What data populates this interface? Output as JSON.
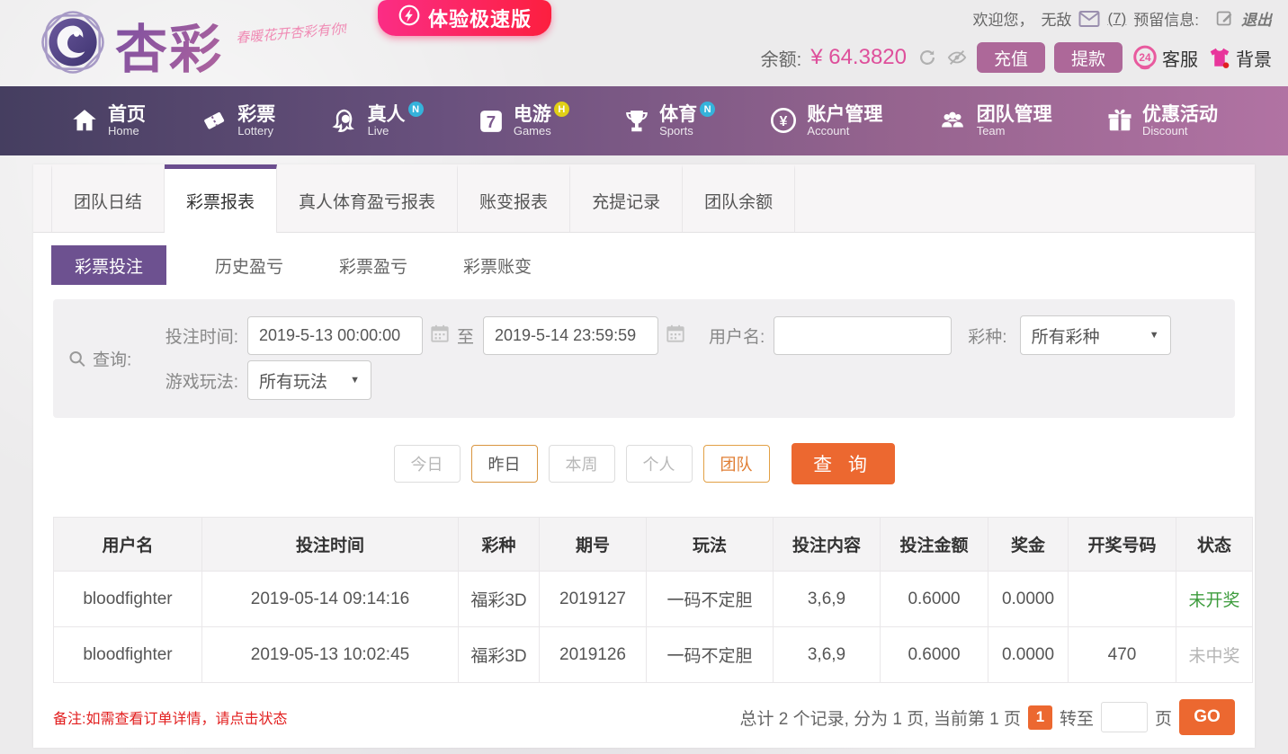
{
  "header": {
    "logo_text": "杏彩",
    "logo_tagline": "春暖花开杏彩有你!",
    "promo_badge": "体验极速版",
    "welcome_text": "欢迎您，",
    "username": "无敌",
    "mail_count": "(7)",
    "reserved_info_label": "预留信息:",
    "logout_label": "退出",
    "balance_label": "余额:",
    "balance_value": "¥ 64.3820",
    "deposit_label": "充值",
    "withdraw_label": "提款",
    "service_label": "客服",
    "background_label": "背景",
    "service_icon_text": "24"
  },
  "nav": {
    "items": [
      {
        "zh": "首页",
        "en": "Home",
        "badge": ""
      },
      {
        "zh": "彩票",
        "en": "Lottery",
        "badge": ""
      },
      {
        "zh": "真人",
        "en": "Live",
        "badge": "N"
      },
      {
        "zh": "电游",
        "en": "Games",
        "badge": "H"
      },
      {
        "zh": "体育",
        "en": "Sports",
        "badge": "N"
      },
      {
        "zh": "账户管理",
        "en": "Account",
        "badge": ""
      },
      {
        "zh": "团队管理",
        "en": "Team",
        "badge": ""
      },
      {
        "zh": "优惠活动",
        "en": "Discount",
        "badge": ""
      }
    ]
  },
  "tabs": {
    "items": [
      "团队日结",
      "彩票报表",
      "真人体育盈亏报表",
      "账变报表",
      "充提记录",
      "团队余额"
    ],
    "active": "彩票报表"
  },
  "subtabs": {
    "items": [
      "彩票投注",
      "历史盈亏",
      "彩票盈亏",
      "彩票账变"
    ],
    "active": "彩票投注"
  },
  "search": {
    "query_label": "查询:",
    "bet_time_label": "投注时间:",
    "date_from": "2019-5-13 00:00:00",
    "to_label": "至",
    "date_to": "2019-5-14 23:59:59",
    "username_label": "用户名:",
    "username_value": "",
    "lottery_type_label": "彩种:",
    "lottery_type_value": "所有彩种",
    "play_label": "游戏玩法:",
    "play_value": "所有玩法"
  },
  "filters": {
    "today": "今日",
    "yesterday": "昨日",
    "week": "本周",
    "personal": "个人",
    "team": "团队",
    "submit": "查 询"
  },
  "table": {
    "headers": [
      "用户名",
      "投注时间",
      "彩种",
      "期号",
      "玩法",
      "投注内容",
      "投注金额",
      "奖金",
      "开奖号码",
      "状态"
    ],
    "rows": [
      {
        "username": "bloodfighter",
        "time": "2019-05-14 09:14:16",
        "lottery": "福彩3D",
        "issue": "2019127",
        "play": "一码不定胆",
        "content": "3,6,9",
        "amount": "0.6000",
        "prize": "0.0000",
        "numbers": "",
        "status": "未开奖"
      },
      {
        "username": "bloodfighter",
        "time": "2019-05-13 10:02:45",
        "lottery": "福彩3D",
        "issue": "2019126",
        "play": "一码不定胆",
        "content": "3,6,9",
        "amount": "0.6000",
        "prize": "0.0000",
        "numbers": "470",
        "status": "未中奖"
      }
    ]
  },
  "footer": {
    "note": "备注:如需查看订单详情，请点击状态",
    "pagination_text": "总计 2 个记录, 分为 1 页, 当前第 1 页",
    "current_page": "1",
    "goto_label": "转至",
    "page_unit_label": "页",
    "go_label": "GO"
  },
  "colors": {
    "brand_purple": "#6d5190",
    "nav_gradient_start": "#453e60",
    "nav_gradient_end": "#b173a3",
    "accent_pink": "#de4f9b",
    "accent_orange": "#ec6830",
    "badge_pink": "#fb2d85",
    "status_pending_green": "#3d9c3d",
    "status_lost_gray": "#b5b5b5",
    "note_red": "#e21f1f"
  }
}
